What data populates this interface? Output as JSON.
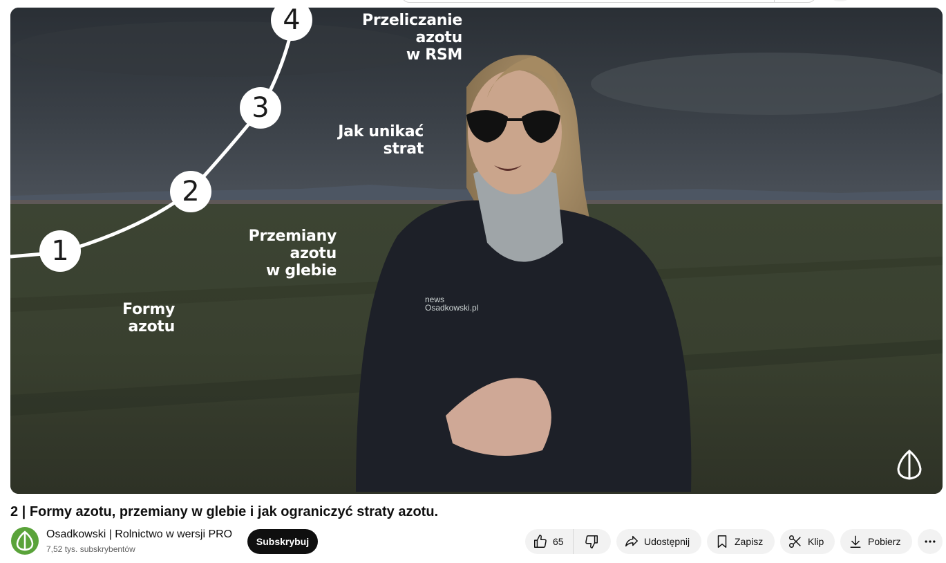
{
  "video": {
    "steps": [
      {
        "num": "1",
        "label_line1": "Formy",
        "label_line2": "azotu"
      },
      {
        "num": "2",
        "label_line1": "Przemiany azotu",
        "label_line2": "w glebie"
      },
      {
        "num": "3",
        "label_line1": "Jak unikać",
        "label_line2": "strat"
      },
      {
        "num": "4",
        "label_line1": "Przeliczanie azotu",
        "label_line2": "w RSM"
      }
    ],
    "jacket_logo_line1": "news",
    "jacket_logo_line2": "Osadkowski.pl"
  },
  "meta": {
    "title": "2 | Formy azotu, przemiany w glebie i jak ograniczyć straty azotu.",
    "channel_name": "Osadkowski | Rolnictwo w wersji PRO",
    "subscribers": "7,52 tys. subskrybentów",
    "subscribe_label": "Subskrybuj"
  },
  "actions": {
    "like_count": "65",
    "share_label": "Udostępnij",
    "save_label": "Zapisz",
    "clip_label": "Klip",
    "download_label": "Pobierz"
  },
  "icons": {
    "like": "thumbs-up-icon",
    "dislike": "thumbs-down-icon",
    "share": "share-arrow-icon",
    "save": "bookmark-icon",
    "clip": "scissors-icon",
    "download": "download-icon",
    "more": "more-horizontal-icon",
    "watermark": "osadkowski-logo-icon",
    "avatar": "channel-logo-icon"
  },
  "colors": {
    "accent_green": "#5aa33a",
    "subscribe_bg": "#0f0f0f",
    "pill_bg": "#f2f2f2"
  }
}
